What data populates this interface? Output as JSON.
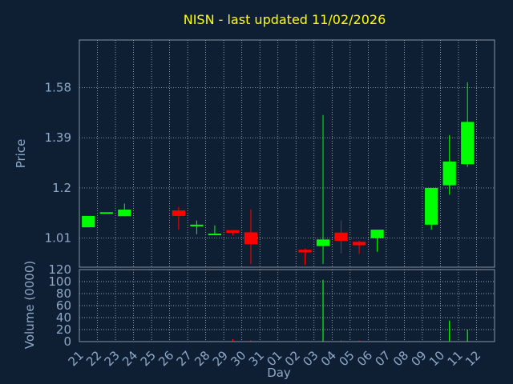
{
  "theme": {
    "background": "#0f1f33",
    "plot_background": "#0f1f33",
    "frame": "#8a93a3",
    "grid": "#c8ccd4",
    "axis_text": "#8fa8c8",
    "title_color": "#ffff00",
    "up_color": "#00ff00",
    "down_color": "#ff0000"
  },
  "chart_data": {
    "type": "candlestick",
    "title": "NISN - last updated 11/02/2026",
    "xlabel": "Day",
    "price_ylabel": "Price",
    "volume_ylabel": "Volume (0000)",
    "x_ticks": [
      "21",
      "22",
      "23",
      "24",
      "25",
      "26",
      "27",
      "28",
      "29",
      "30",
      "31",
      "01",
      "02",
      "03",
      "04",
      "05",
      "06",
      "07",
      "08",
      "09",
      "10",
      "11",
      "12"
    ],
    "price_ticks": [
      "1.01",
      "1.2",
      "1.39",
      "1.58"
    ],
    "price_tick_values": [
      1.01,
      1.2,
      1.39,
      1.58
    ],
    "price_ylim": [
      0.9,
      1.76
    ],
    "volume_ticks": [
      "0",
      "20",
      "40",
      "60",
      "80",
      "100",
      "120"
    ],
    "volume_tick_values": [
      0,
      20,
      40,
      60,
      80,
      100,
      120
    ],
    "volume_ylim": [
      0,
      120
    ],
    "grid": true,
    "candles": [
      {
        "day": "21",
        "open": 1.051,
        "high": 1.094,
        "low": 1.051,
        "close": 1.094
      },
      {
        "day": "22",
        "open": 1.108,
        "high": 1.108,
        "low": 1.108,
        "close": 1.108
      },
      {
        "day": "23",
        "open": 1.093,
        "high": 1.141,
        "low": 1.093,
        "close": 1.118
      },
      {
        "day": "26",
        "open": 1.115,
        "high": 1.128,
        "low": 1.042,
        "close": 1.094
      },
      {
        "day": "27",
        "open": 1.061,
        "high": 1.077,
        "low": 1.025,
        "close": 1.061
      },
      {
        "day": "28",
        "open": 1.027,
        "high": 1.058,
        "low": 1.021,
        "close": 1.027
      },
      {
        "day": "29",
        "open": 1.04,
        "high": 1.04,
        "low": 1.02,
        "close": 1.03
      },
      {
        "day": "30",
        "open": 1.032,
        "high": 1.119,
        "low": 0.912,
        "close": 0.987
      },
      {
        "day": "02",
        "open": 0.966,
        "high": 0.97,
        "low": 0.908,
        "close": 0.956
      },
      {
        "day": "03",
        "open": 0.98,
        "high": 1.476,
        "low": 0.912,
        "close": 1.005
      },
      {
        "day": "04",
        "open": 1.031,
        "high": 1.077,
        "low": 0.952,
        "close": 1.0
      },
      {
        "day": "05",
        "open": 0.996,
        "high": 1.0,
        "low": 0.951,
        "close": 0.983
      },
      {
        "day": "06",
        "open": 1.01,
        "high": 1.042,
        "low": 0.958,
        "close": 1.042
      },
      {
        "day": "09",
        "open": 1.061,
        "high": 1.196,
        "low": 1.042,
        "close": 1.2
      },
      {
        "day": "10",
        "open": 1.21,
        "high": 1.4,
        "low": 1.174,
        "close": 1.3
      },
      {
        "day": "11",
        "open": 1.29,
        "high": 1.6,
        "low": 1.28,
        "close": 1.45
      }
    ],
    "volumes": [
      {
        "day": "29",
        "value": 4,
        "color": "red"
      },
      {
        "day": "30",
        "value": 2,
        "color": "red"
      },
      {
        "day": "03",
        "value": 103,
        "color": "green"
      },
      {
        "day": "04",
        "value": 2,
        "color": "red"
      },
      {
        "day": "05",
        "value": 2,
        "color": "red"
      },
      {
        "day": "10",
        "value": 35,
        "color": "green"
      },
      {
        "day": "11",
        "value": 20,
        "color": "green"
      }
    ]
  }
}
